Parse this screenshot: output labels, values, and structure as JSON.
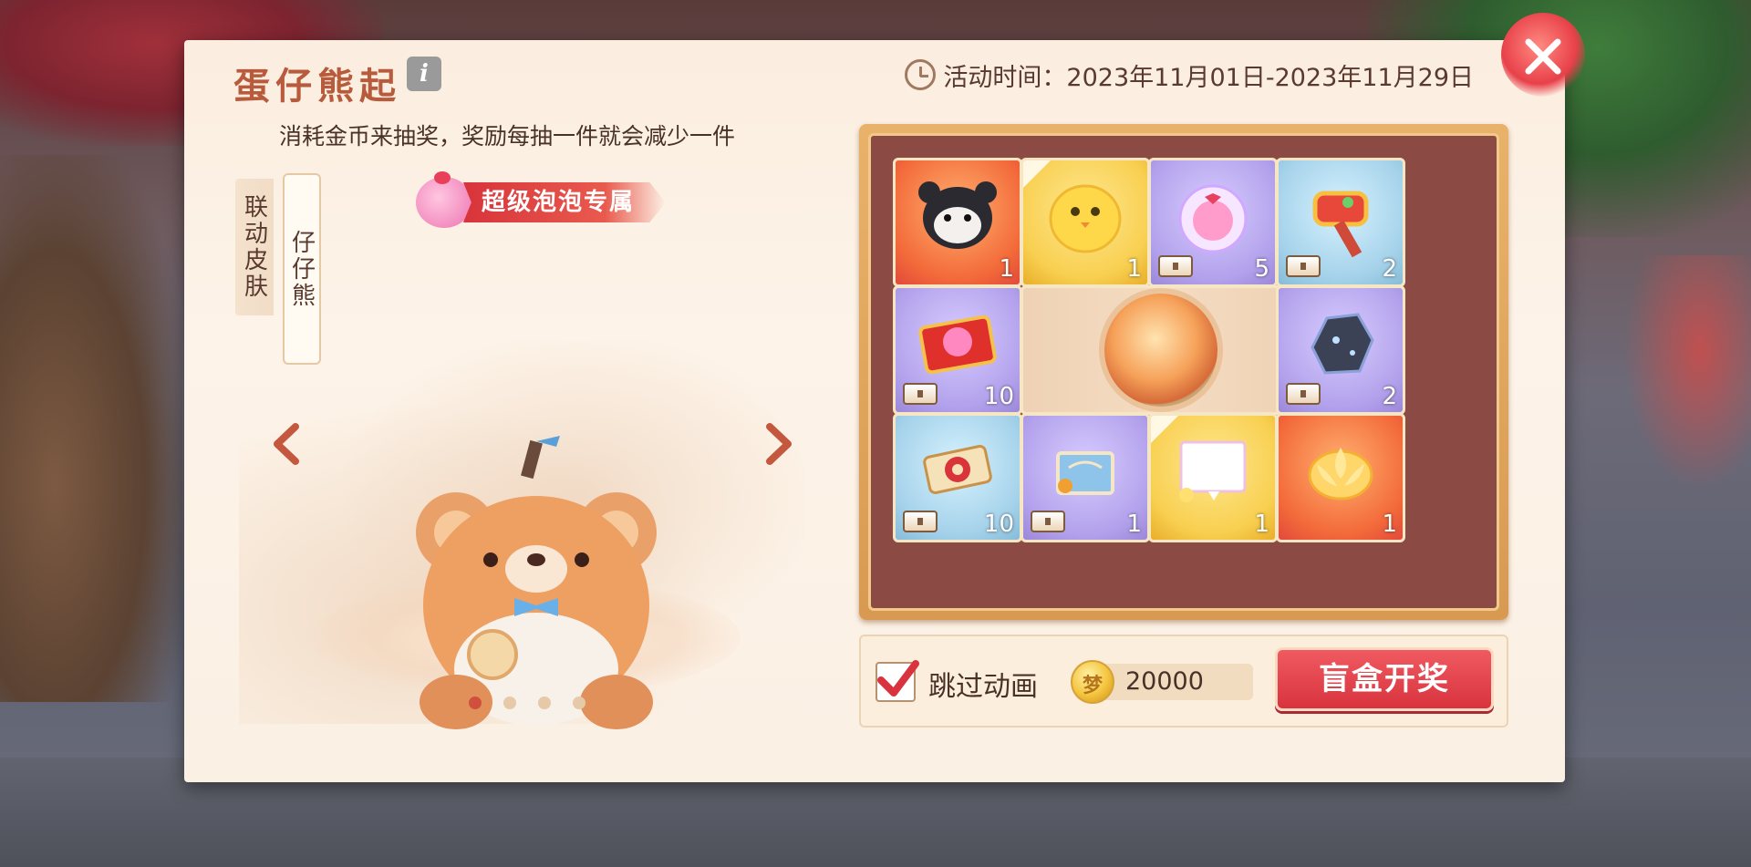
{
  "header": {
    "title": "蛋仔熊起",
    "info_icon_glyph": "i",
    "activity_time": "活动时间：2023年11月01日-2023年11月29日"
  },
  "description": "消耗金币来抽奖，奖励每抽一件就会减少一件",
  "tabs": [
    {
      "label": "联动皮肤",
      "active": false
    },
    {
      "label": "仔仔熊",
      "active": true
    }
  ],
  "badge": {
    "label": "超级泡泡专属"
  },
  "carousel": {
    "page_count": 4,
    "active_index": 0
  },
  "prize_grid": {
    "items": [
      {
        "name": "black-white-bear-skin",
        "rarity": "orange",
        "count": "1",
        "has_chest": false,
        "new_corner": false
      },
      {
        "name": "yellow-bird-costume",
        "rarity": "gold",
        "count": "1",
        "has_chest": false,
        "new_corner": true
      },
      {
        "name": "pink-pet-bubble",
        "rarity": "purple",
        "count": "5",
        "has_chest": true,
        "new_corner": false
      },
      {
        "name": "golden-hammer",
        "rarity": "blue",
        "count": "2",
        "has_chest": true,
        "new_corner": false
      },
      {
        "name": "pink-card-ticket",
        "rarity": "purple",
        "count": "10",
        "has_chest": true,
        "new_corner": false
      },
      {
        "name": "blue-ore-stone",
        "rarity": "purple",
        "count": "2",
        "has_chest": true,
        "new_corner": false
      },
      {
        "name": "red-scroll",
        "rarity": "blue",
        "count": "10",
        "has_chest": true,
        "new_corner": false
      },
      {
        "name": "blue-book-set",
        "rarity": "purple",
        "count": "1",
        "has_chest": true,
        "new_corner": false
      },
      {
        "name": "chat-bubble-frame",
        "rarity": "gold",
        "count": "1",
        "has_chest": false,
        "new_corner": true
      },
      {
        "name": "golden-lotus",
        "rarity": "orange",
        "count": "1",
        "has_chest": false,
        "new_corner": false
      }
    ]
  },
  "bottom": {
    "skip_label": "跳过动画",
    "skip_checked": true,
    "coin_amount": "20000",
    "open_button": "盲盒开奖"
  },
  "colors": {
    "accent_red": "#d8333e",
    "title_color": "#b85b3c",
    "text_brown": "#4a3128"
  }
}
